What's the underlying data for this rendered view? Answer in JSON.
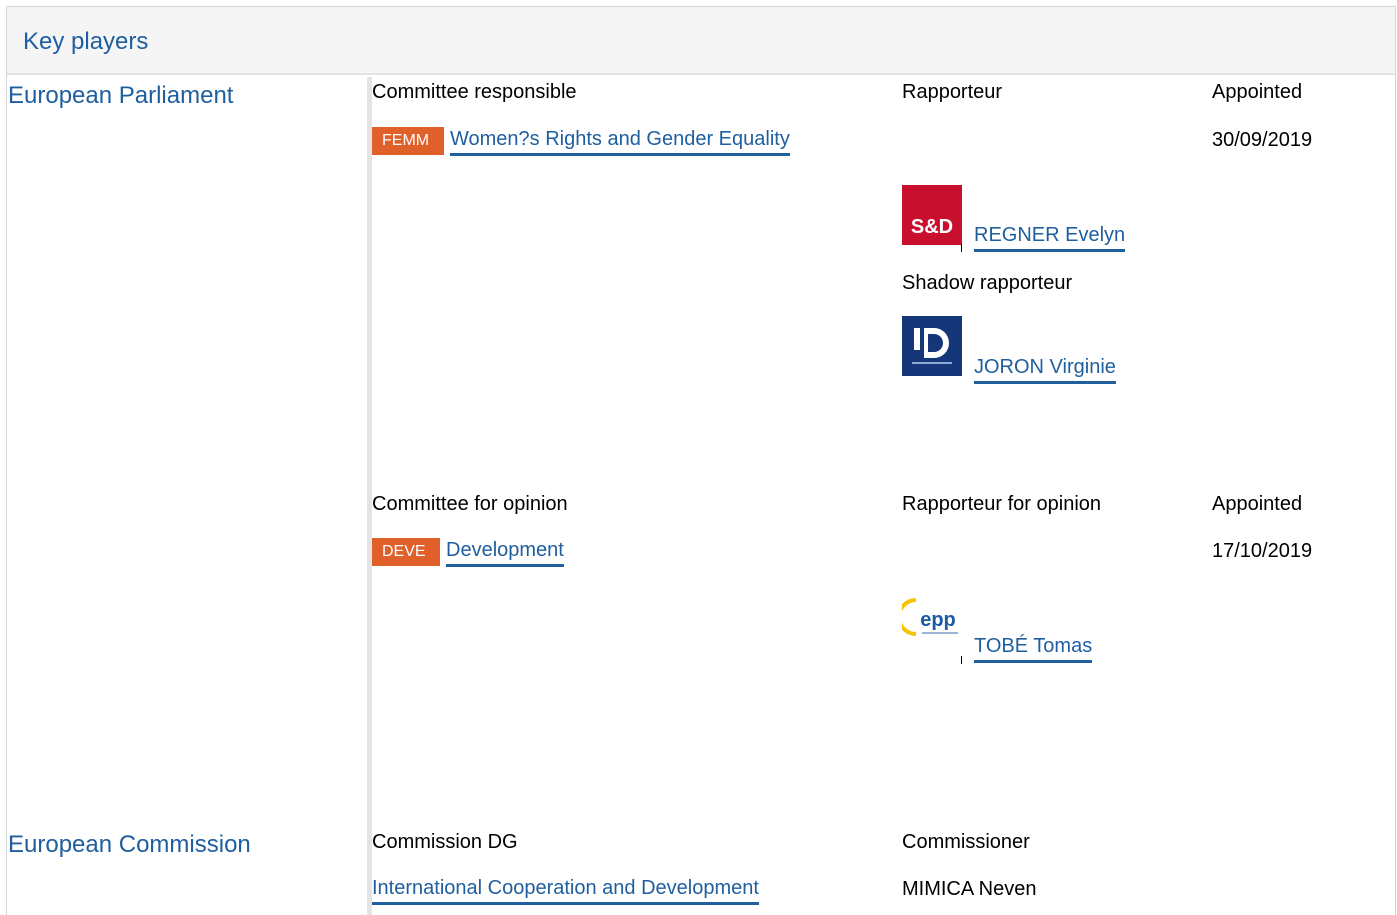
{
  "header": {
    "title": "Key players"
  },
  "parliament": {
    "institution": "European Parliament",
    "responsible": {
      "section_label": "Committee responsible",
      "rapporteur_label": "Rapporteur",
      "appointed_label": "Appointed",
      "committee_code": "FEMM",
      "committee_name": "Women?s Rights and Gender Equality",
      "appointed_date": "30/09/2019",
      "rapporteur": {
        "name": "REGNER Evelyn",
        "group_logo_text": "S&D",
        "group_color": "#c8102e"
      },
      "shadow_label": "Shadow rapporteur",
      "shadow": {
        "name": "JORON Virginie",
        "group_logo_text": "ID",
        "group_color": "#16367a"
      }
    },
    "opinion": {
      "section_label": "Committee for opinion",
      "rapporteur_label": "Rapporteur for opinion",
      "appointed_label": "Appointed",
      "committee_code": "DEVE",
      "committee_name": "Development",
      "appointed_date": "17/10/2019",
      "rapporteur": {
        "name": "TOBÉ Tomas",
        "group_logo_text": "epp",
        "group_color": "#1c5aa6"
      }
    }
  },
  "commission": {
    "institution": "European Commission",
    "dg_label": "Commission DG",
    "commissioner_label": "Commissioner",
    "dg_name": "International Cooperation and Development",
    "commissioner_name": "MIMICA Neven"
  },
  "colors": {
    "accent": "#1f5fa0",
    "badge": "#e0602a",
    "band": "#e4e4e4"
  }
}
